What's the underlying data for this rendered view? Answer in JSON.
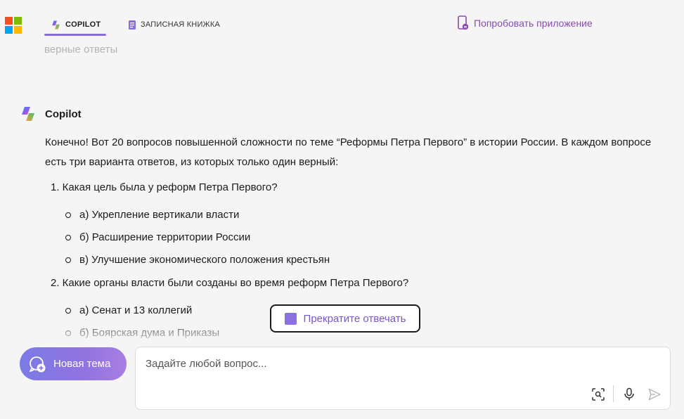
{
  "header": {
    "tabs": [
      {
        "label": "COPILOT",
        "active": true
      },
      {
        "label": "ЗАПИСНАЯ КНИЖКА",
        "active": false
      }
    ],
    "try_app_label": "Попробовать приложение"
  },
  "faded_previous_text": "верные ответы",
  "message": {
    "author": "Copilot",
    "intro": "Конечно! Вот 20 вопросов повышенной сложности по теме “Реформы Петра Первого” в истории России. В каждом вопросе есть три варианта ответов, из которых только один верный:",
    "questions": [
      {
        "text": "1. Какая цель была у реформ Петра Первого?",
        "options": [
          "а) Укрепление вертикали власти",
          "б) Расширение территории России",
          "в) Улучшение экономического положения крестьян"
        ]
      },
      {
        "text": "2. Какие органы власти были созданы во время реформ Петра Первого?",
        "options": [
          "а) Сенат и 13 коллегий",
          "б) Боярская дума и Приказы"
        ]
      }
    ]
  },
  "stop_button_label": "Прекратите отвечать",
  "new_topic_label": "Новая тема",
  "input": {
    "placeholder": "Задайте любой вопрос...",
    "value": ""
  },
  "colors": {
    "accent": "#8b6be0",
    "try_app": "#8a4bb0",
    "stop_text": "#7a54c9",
    "ms_logo": [
      "#f25022",
      "#7fba00",
      "#00a4ef",
      "#ffb900"
    ]
  },
  "icons": [
    "microsoft-logo",
    "copilot-icon",
    "notebook-icon",
    "phone-app-icon",
    "stop-icon",
    "new-chat-icon",
    "visual-search-icon",
    "microphone-icon",
    "send-icon"
  ]
}
